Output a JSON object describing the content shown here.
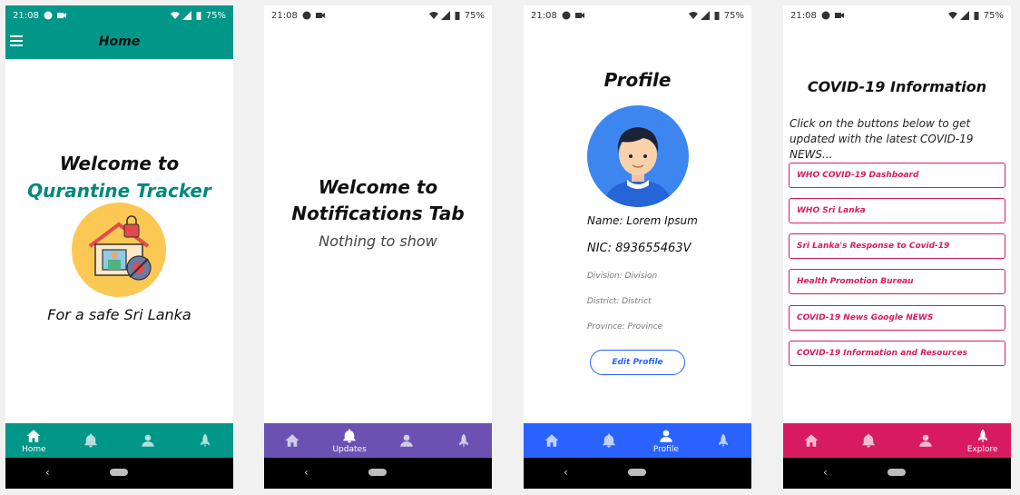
{
  "status": {
    "time": "21:08",
    "battery": "75%"
  },
  "colors": {
    "home": "#009688",
    "updates": "#6a51b2",
    "profile": "#2962ff",
    "explore": "#d81b60"
  },
  "home": {
    "app_bar_title": "Home",
    "welcome": "Welcome to",
    "app_name": "Qurantine Tracker",
    "tagline": "For a safe Sri Lanka",
    "illustration_icon": "house-lock-person-virus-icon"
  },
  "updates": {
    "welcome_line1": "Welcome to",
    "welcome_line2": "Notifications Tab",
    "empty_text": "Nothing to show"
  },
  "profile": {
    "title": "Profile",
    "avatar_icon": "user-avatar-icon",
    "name": "Name: Lorem Ipsum",
    "nic": "NIC: 893655463V",
    "division": "Division: Division",
    "district": "District: District",
    "province": "Province: Province",
    "edit_button": "Edit Profile"
  },
  "explore": {
    "title": "COVID-19 Information",
    "intro": "Click on the buttons below to get updated with the latest COVID-19 NEWS...",
    "links": [
      "WHO COVID-19 Dashboard",
      "WHO Sri Lanka",
      "Sri Lanka's Response to Covid-19",
      "Health Promotion Bureau",
      "COVID-19 News Google NEWS",
      "COVID-19 Information and Resources"
    ]
  },
  "nav": {
    "home": "Home",
    "updates": "Updates",
    "profile": "Profile",
    "explore": "Explore"
  }
}
